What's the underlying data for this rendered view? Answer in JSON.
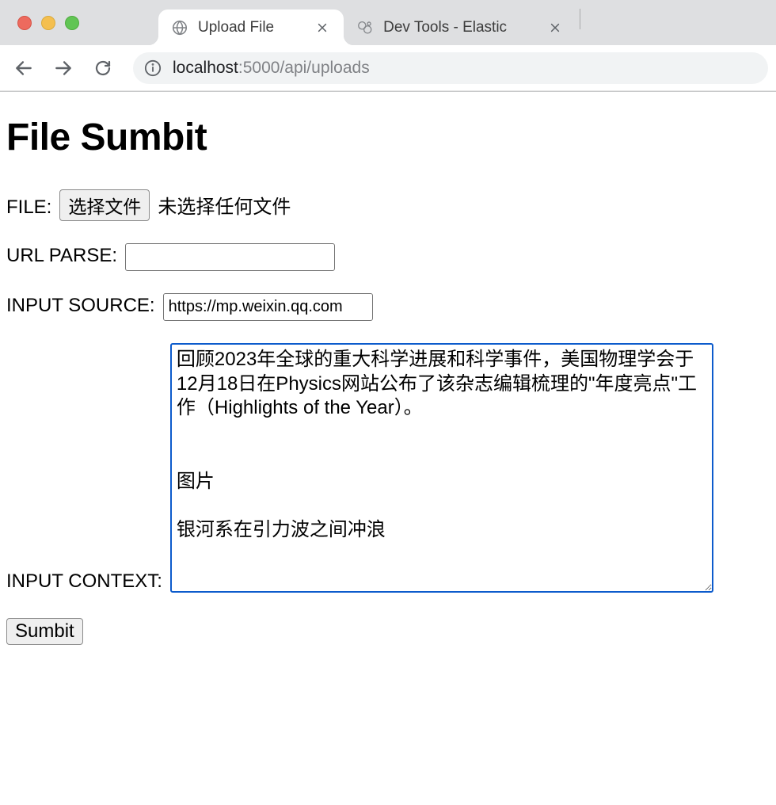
{
  "browser": {
    "tabs": [
      {
        "title": "Upload File",
        "active": true
      },
      {
        "title": "Dev Tools - Elastic",
        "active": false
      }
    ],
    "url_host": "localhost",
    "url_path": ":5000/api/uploads"
  },
  "page": {
    "heading": "File Sumbit",
    "file": {
      "label": "FILE:",
      "button": "选择文件",
      "status": "未选择任何文件"
    },
    "url_parse": {
      "label": "URL PARSE:",
      "value": ""
    },
    "input_source": {
      "label": "INPUT SOURCE:",
      "value": "https://mp.weixin.qq.com"
    },
    "input_context": {
      "label": "INPUT CONTEXT:",
      "value": "回顾2023年全球的重大科学进展和科学事件，美国物理学会于12月18日在Physics网站公布了该杂志编辑梳理的\"年度亮点\"工作（Highlights of the Year）。\n\n\n图片\n\n银河系在引力波之间冲浪"
    },
    "submit_label": "Sumbit"
  }
}
